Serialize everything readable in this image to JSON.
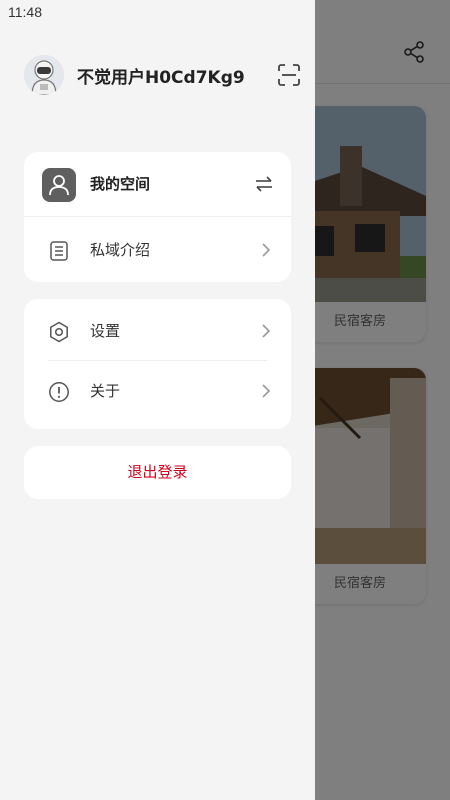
{
  "status_bar": {
    "time": "11:48"
  },
  "drawer": {
    "user": {
      "name": "不觉用户H0Cd7Kg9"
    },
    "menu_group_1": [
      {
        "label": "我的空间",
        "icon": "user-icon"
      },
      {
        "label": "私域介绍",
        "icon": "list-icon"
      }
    ],
    "menu_group_2": [
      {
        "label": "设置",
        "icon": "gear-icon"
      },
      {
        "label": "关于",
        "icon": "info-icon"
      }
    ],
    "logout_label": "退出登录"
  },
  "background": {
    "cards": [
      {
        "label": "民宿客房"
      },
      {
        "label": "民宿客房"
      }
    ]
  },
  "colors": {
    "logout": "#d0021b",
    "drawer_bg": "#f4f4f4",
    "overlay": "rgba(0,0,0,0.5)"
  }
}
